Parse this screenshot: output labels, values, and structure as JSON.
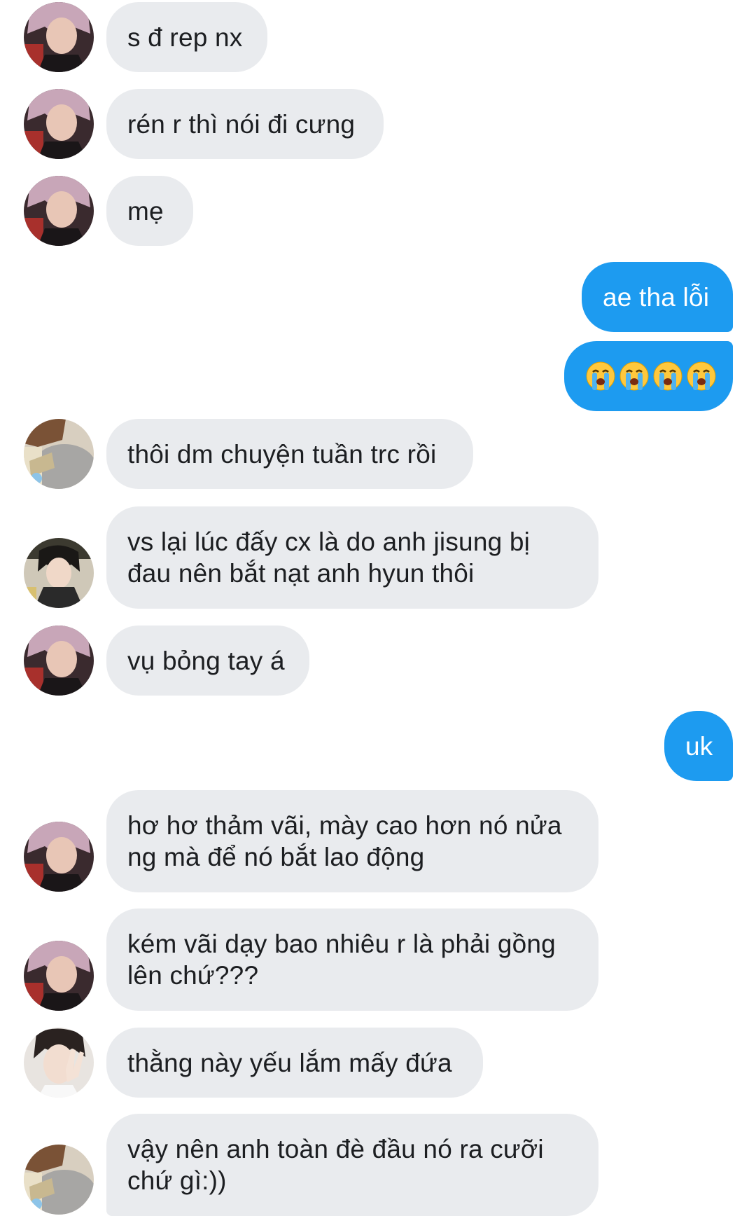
{
  "messages": [
    {
      "id": "m1",
      "side": "in",
      "avatar": "avatar-a",
      "text": "s đ rep nx"
    },
    {
      "id": "m2",
      "side": "in",
      "avatar": "avatar-a",
      "text": "rén r thì nói đi cưng"
    },
    {
      "id": "m3",
      "side": "in",
      "avatar": "avatar-a",
      "text": "mẹ"
    },
    {
      "id": "m4",
      "side": "out",
      "text": "ae tha lỗi"
    },
    {
      "id": "m5",
      "side": "out",
      "emoji": "loudly-crying-face",
      "emoji_count": 4
    },
    {
      "id": "m6",
      "side": "in",
      "avatar": "avatar-b",
      "text": "thôi dm chuyện tuần trc rồi"
    },
    {
      "id": "m7",
      "side": "in",
      "avatar": "avatar-c",
      "text": "vs lại lúc đấy cx là do anh jisung bị\nđau nên bắt nạt anh hyun thôi"
    },
    {
      "id": "m8",
      "side": "in",
      "avatar": "avatar-a",
      "text": "vụ bỏng tay á"
    },
    {
      "id": "m9",
      "side": "out",
      "text": "uk"
    },
    {
      "id": "m10",
      "side": "in",
      "avatar": "avatar-a",
      "text": "hơ hơ thảm vãi, mày cao hơn nó nửa\nng mà để nó bắt lao động"
    },
    {
      "id": "m11",
      "side": "in",
      "avatar": "avatar-a",
      "text": "kém vãi dạy bao nhiêu r là phải gồng\nlên chứ???"
    },
    {
      "id": "m12",
      "side": "in",
      "avatar": "avatar-d",
      "text": "thằng này yếu lắm mấy đứa"
    },
    {
      "id": "m13",
      "side": "in",
      "avatar": "avatar-b",
      "text": "vậy nên anh toàn đè đầu nó ra cưỡi\nchứ gì:))"
    }
  ],
  "colors": {
    "outgoing_bubble": "#1d9bf0",
    "incoming_bubble": "#e9ebee",
    "incoming_text": "#1c1e21",
    "outgoing_text": "#ffffff"
  }
}
